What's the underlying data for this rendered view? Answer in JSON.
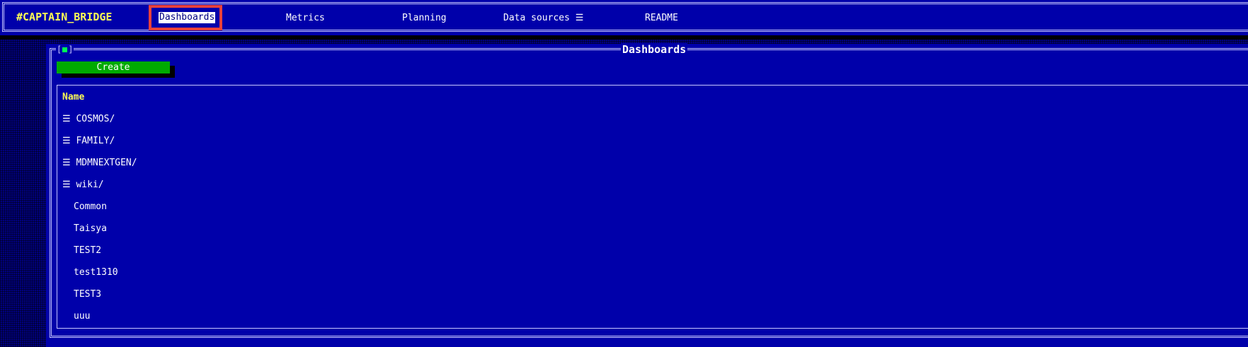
{
  "app": {
    "brand": "#CAPTAIN_BRIDGE"
  },
  "nav": {
    "items": [
      {
        "label": "Dashboards",
        "active": true
      },
      {
        "label": "Metrics"
      },
      {
        "label": "Planning"
      },
      {
        "label": "Data sources ☰"
      },
      {
        "label": "README"
      }
    ]
  },
  "panel": {
    "title": "Dashboards",
    "close_label": "[■]",
    "create_label": "Create"
  },
  "table": {
    "header": "Name",
    "folders": [
      {
        "label": "☰ COSMOS/"
      },
      {
        "label": "☰ FAMILY/"
      },
      {
        "label": "☰ MDMNEXTGEN/"
      },
      {
        "label": "☰ wiki/"
      }
    ],
    "items": [
      {
        "label": "Common"
      },
      {
        "label": "Taisya"
      },
      {
        "label": "TEST2"
      },
      {
        "label": "test1310"
      },
      {
        "label": "TEST3"
      },
      {
        "label": "uuu"
      }
    ]
  },
  "colors": {
    "background": "#0000aa",
    "brand": "#ffff55",
    "accent_create": "#00aa00",
    "active_highlight": "#e8413c"
  }
}
